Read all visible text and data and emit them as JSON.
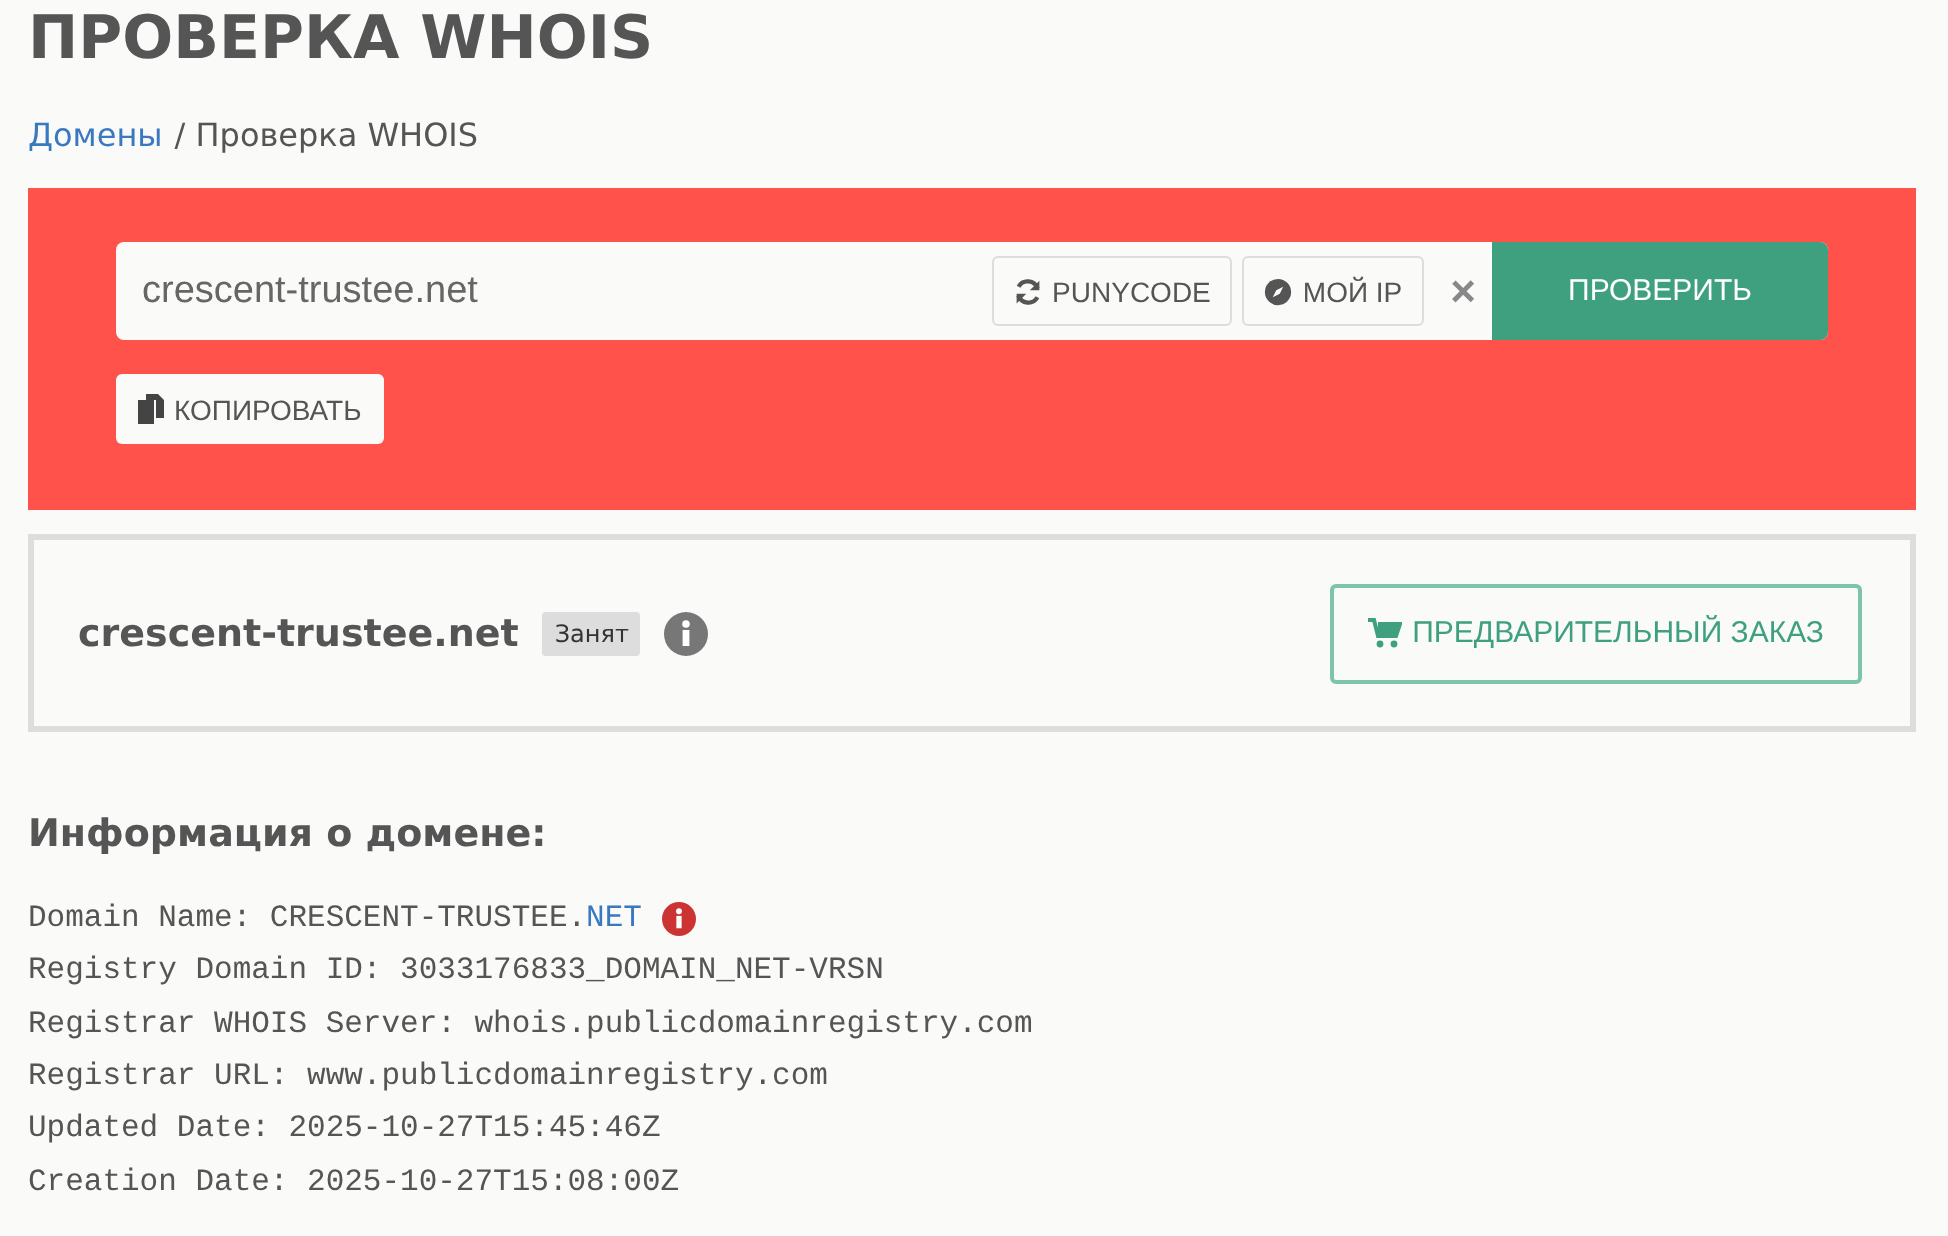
{
  "page": {
    "title": "ПРОВЕРКА WHOIS"
  },
  "breadcrumb": [
    {
      "label": "Домены",
      "kind": "link"
    },
    {
      "label": "/ Проверка WHOIS",
      "kind": "current"
    }
  ],
  "search": {
    "value": "crescent-trustee.net",
    "punycode_button": "PUNYCODE",
    "my_ip_button": "МОЙ IP",
    "clear_button": "×",
    "check_button": "ПРОВЕРИТЬ",
    "copy_button": "КОПИРОВАТЬ"
  },
  "result": {
    "domain": "crescent-trustee.net",
    "status": "Занят",
    "preorder_button": "ПРЕДВАРИТЕЛЬНЫЙ ЗАКАЗ"
  },
  "info": {
    "heading": "Информация о домене:",
    "lines": [
      {
        "text": "Domain Name: CRESCENT-TRUSTEE.",
        "link": "NET",
        "alert": true
      },
      {
        "text": "Registry Domain ID: 3033176833_DOMAIN_NET-VRSN",
        "alert": false
      },
      {
        "text": "Registrar WHOIS Server: whois.publicdomainregistry.com",
        "alert": false
      },
      {
        "text": "Registrar URL: www.publicdomainregistry.com",
        "alert": false
      },
      {
        "text": "Updated Date: 2025-10-27T15:45:46Z",
        "alert": false
      },
      {
        "text": "Creation Date: 2025-10-27T15:08:00Z",
        "alert": false
      }
    ]
  }
}
